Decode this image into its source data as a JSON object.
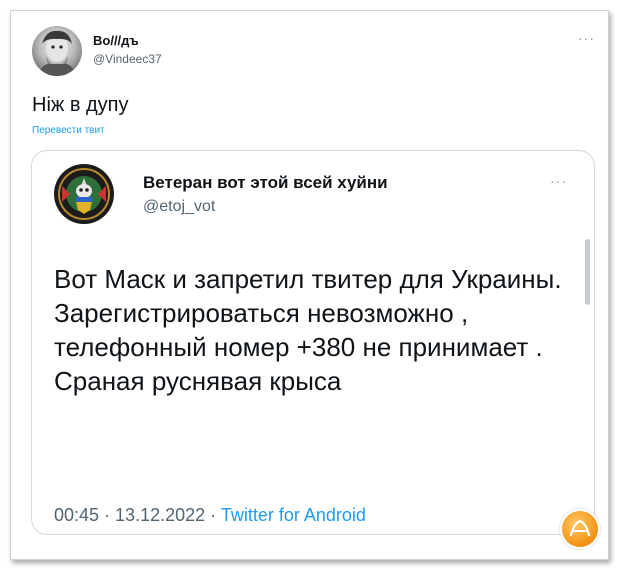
{
  "outer_tweet": {
    "author_name": "Во///дъ",
    "handle": "@Vindeec37",
    "more": "···",
    "text": "Ніж в дупу",
    "translate_link": "Перевести твит"
  },
  "quoted_tweet": {
    "author_name": "Ветеран вот этой всей хуйни",
    "handle": "@etoj_vot",
    "more": "···",
    "body": "Вот Маск и запретил твитер для Украины. Зарегистрироваться невозможно , телефонный номер +380 не принимает . Сраная руснявая крыса",
    "time": "00:45",
    "separator": " · ",
    "date": "13.12.2022",
    "source": "Twitter for Android"
  },
  "colors": {
    "text": "#0f1419",
    "secondary": "#536471",
    "link": "#1d9bf0",
    "border": "#cfd9de"
  }
}
